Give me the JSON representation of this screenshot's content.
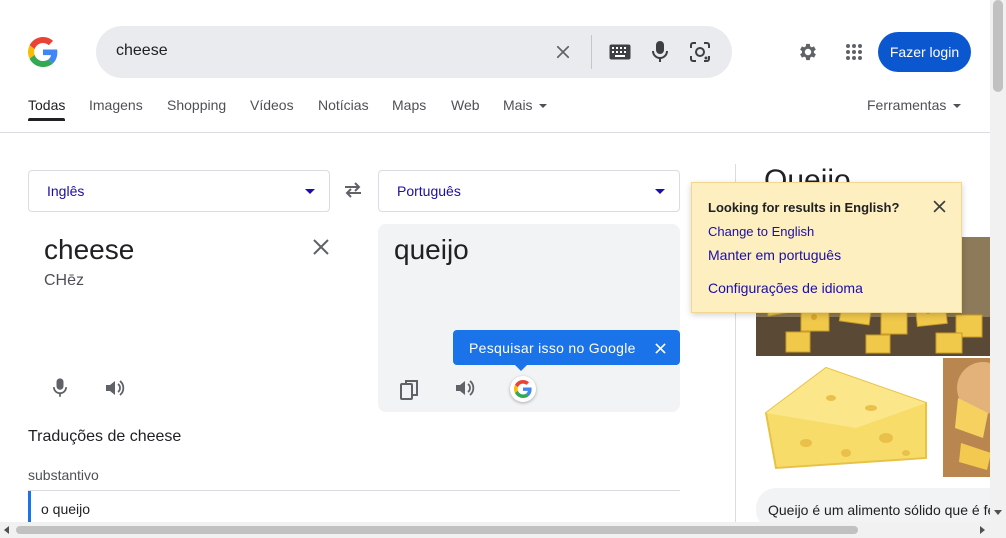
{
  "search": {
    "query": "cheese"
  },
  "header": {
    "login_label": "Fazer login"
  },
  "tabs": [
    {
      "label": "Todas"
    },
    {
      "label": "Imagens"
    },
    {
      "label": "Shopping"
    },
    {
      "label": "Vídeos"
    },
    {
      "label": "Notícias"
    },
    {
      "label": "Maps"
    },
    {
      "label": "Web"
    },
    {
      "label": "Mais"
    }
  ],
  "tools_label": "Ferramentas",
  "translator": {
    "source_lang": "Inglês",
    "target_lang": "Português",
    "source_text": "cheese",
    "source_phonetic": "CHēz",
    "target_text": "queijo",
    "tooltip": "Pesquisar isso no Google"
  },
  "translations": {
    "heading": "Traduções de cheese",
    "part_of_speech": "substantivo",
    "entries": [
      "o queijo"
    ]
  },
  "knowledge_panel": {
    "title": "Queijo",
    "snippet": "Queijo é um alimento sólido que é fe"
  },
  "language_popup": {
    "title": "Looking for results in English?",
    "link_english": "Change to English",
    "link_keep": "Manter em português",
    "link_settings": "Configurações de idioma"
  },
  "colors": {
    "accent_blue": "#1a73e8",
    "login_button": "#0b57d0",
    "link_blue": "#1a0dab",
    "popup_bg": "#fdefc0"
  }
}
